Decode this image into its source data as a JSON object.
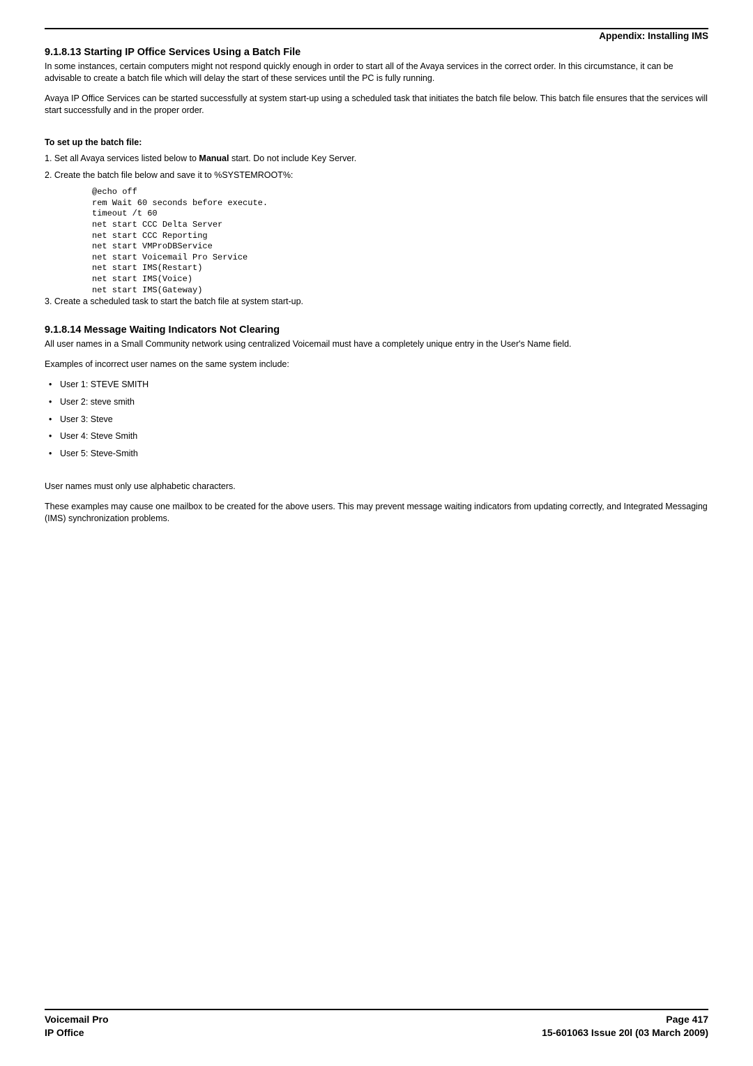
{
  "header": {
    "appendix_label": "Appendix: Installing IMS"
  },
  "section1": {
    "heading": "9.1.8.13 Starting IP Office Services Using a Batch File",
    "para1": "In some instances, certain computers might not respond quickly enough in order to start all of the Avaya services in the correct order. In this circumstance, it can be advisable to create a batch file which will delay the start of these services until the PC is fully running.",
    "para2": "Avaya IP Office Services can be started successfully at system start-up using a scheduled task that initiates the batch file below. This batch file ensures that the services will start successfully and in the proper order.",
    "setup_heading": "To set up the batch file:",
    "step1_pre": "1. Set all Avaya services listed below to ",
    "step1_bold": "Manual",
    "step1_post": " start. Do not include Key Server.",
    "step2": "2. Create the batch file below and save it to %SYSTEMROOT%:",
    "code": "@echo off\nrem Wait 60 seconds before execute.\ntimeout /t 60\nnet start CCC Delta Server\nnet start CCC Reporting\nnet start VMProDBService\nnet start Voicemail Pro Service\nnet start IMS(Restart)\nnet start IMS(Voice)\nnet start IMS(Gateway)",
    "step3": "3. Create a scheduled task to start the batch file at system start-up."
  },
  "section2": {
    "heading": "9.1.8.14 Message Waiting Indicators Not Clearing",
    "para1": "All user names in a Small Community network using centralized Voicemail must have a completely unique entry in the User's Name field.",
    "para2": "Examples of incorrect user names on the same system include:",
    "bullets": [
      "User 1: STEVE SMITH",
      "User 2: steve smith",
      "User 3: Steve",
      "User 4: Steve Smith",
      "User 5: Steve-Smith"
    ],
    "para3": "User names must only use alphabetic characters.",
    "para4": "These examples may cause one mailbox to be created for the above users. This may prevent message waiting indicators from updating correctly, and Integrated Messaging (IMS) synchronization problems."
  },
  "footer": {
    "left_line1": "Voicemail Pro",
    "left_line2": "IP Office",
    "right_line1": "Page 417",
    "right_line2": "15-601063 Issue 20l (03 March 2009)"
  }
}
